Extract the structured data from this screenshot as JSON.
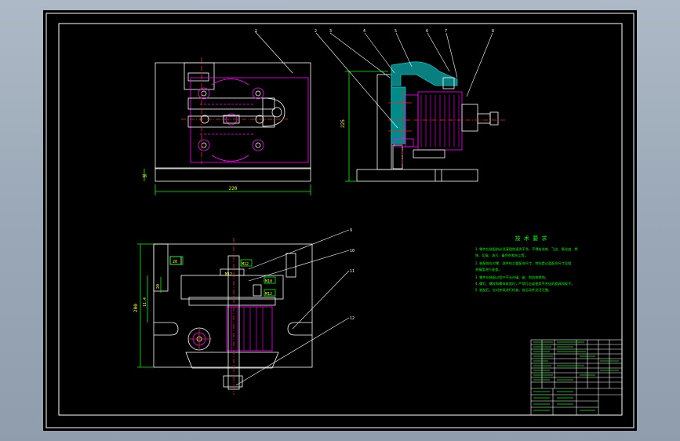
{
  "drawing": {
    "part_balloons_top": [
      "1",
      "2",
      "3",
      "4",
      "5",
      "6",
      "7",
      "8"
    ],
    "part_balloons_bottom": [
      "9",
      "10",
      "11",
      "12"
    ],
    "dim_width_top": "220",
    "dim_height_right": "225",
    "dim_height_bottom": "200",
    "dim_small_h": "18",
    "dim_offset": "20",
    "dim_sub": "11.4",
    "dim_tag_a": "M12",
    "dim_tag_b": "M10",
    "dim_tag_c": "M12",
    "dim_tag_d": "M12",
    "dim_mini": "20",
    "notes_title": "技 术 要 求",
    "notes": [
      "1.零件在装配前必须清理和清洗干净，不得有毛刺、飞边、氧化皮、锈",
      "蚀、切屑、油污、着色剂和灰尘等。",
      "2.装配前应对零、部件的主要配合尺寸，特别是过盈配合尺寸及相",
      "关精度进行复查。",
      "3.零件在装配过程中不允许磕、碰、划伤和锈蚀。",
      "4.螺钉、螺栓和螺母紧固时，严禁打击或使用不合适的旋具和扳手。",
      "5.装配后，应对夹具进行检查，各运动件灵活可靠。"
    ]
  },
  "colors": {
    "frame": "#ffffff",
    "outline": "#ffffff",
    "centerline": "#ff2020",
    "magenta": "#ff00ff",
    "cyan": "#00c8c8",
    "green": "#00ff00",
    "yellow": "#ffff00"
  }
}
